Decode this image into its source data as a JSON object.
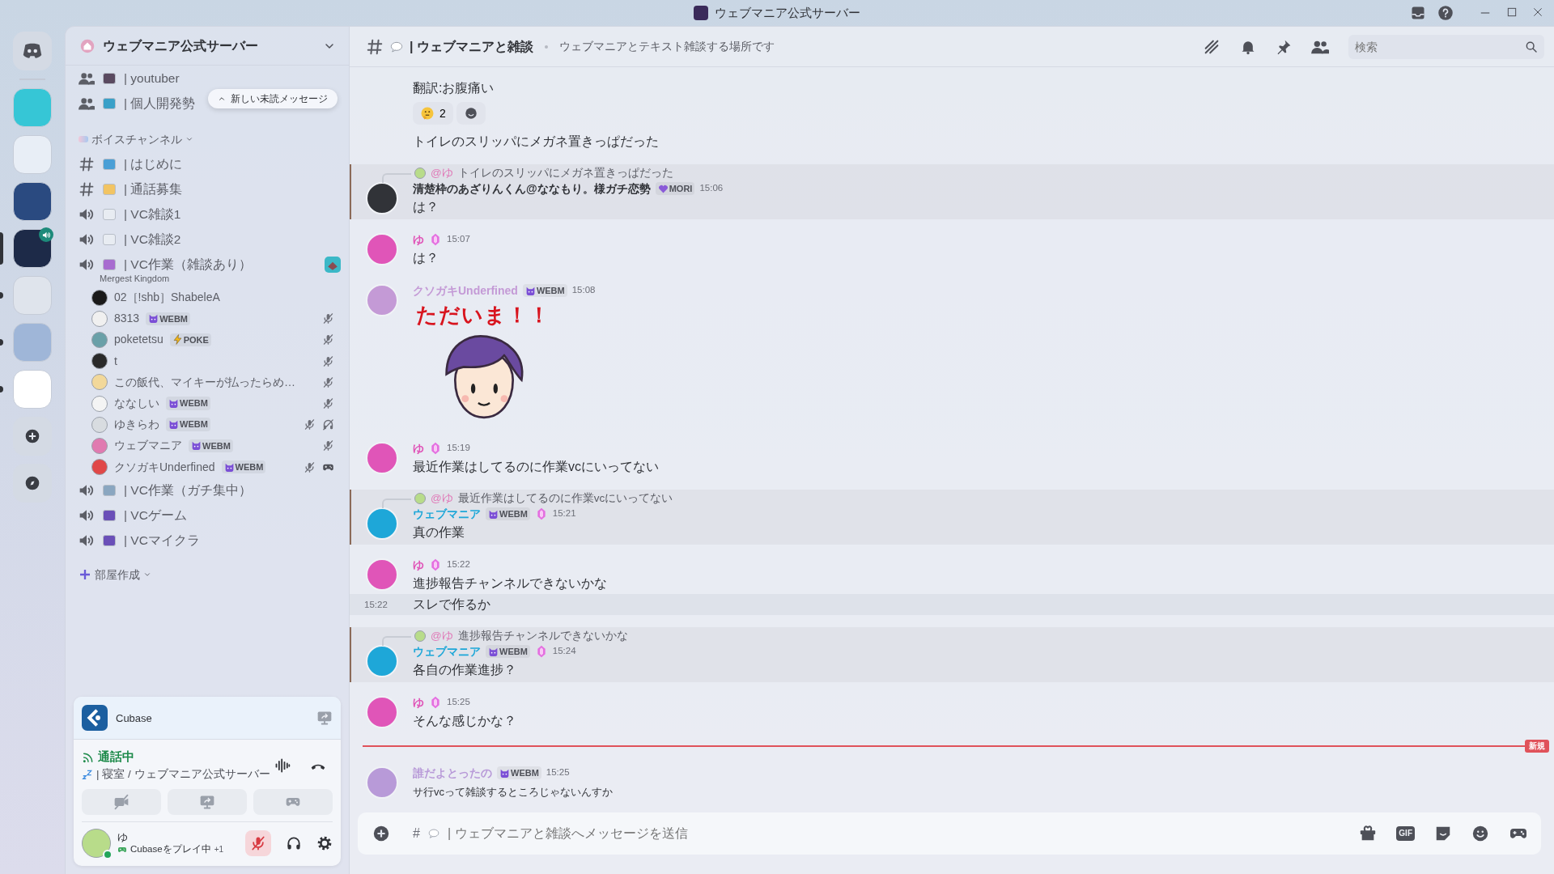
{
  "window": {
    "title": "ウェブマニア公式サーバー"
  },
  "servers": [
    {
      "kind": "home",
      "selected": false,
      "unread": false,
      "voice": false
    },
    {
      "kind": "server",
      "selected": false,
      "unread": false,
      "voice": false
    },
    {
      "kind": "server",
      "selected": false,
      "unread": false,
      "voice": false
    },
    {
      "kind": "server",
      "selected": false,
      "unread": false,
      "voice": false
    },
    {
      "kind": "server",
      "selected": true,
      "unread": false,
      "voice": true
    },
    {
      "kind": "server",
      "selected": false,
      "unread": true,
      "voice": false
    },
    {
      "kind": "server",
      "selected": false,
      "unread": true,
      "voice": false
    },
    {
      "kind": "server",
      "selected": false,
      "unread": true,
      "voice": false
    },
    {
      "kind": "add",
      "selected": false,
      "unread": false,
      "voice": false
    },
    {
      "kind": "discover",
      "selected": false,
      "unread": false,
      "voice": false
    }
  ],
  "server_header": {
    "name": "ウェブマニア公式サーバー"
  },
  "unread_pill": {
    "label": "新しい未読メッセージ"
  },
  "channels": [
    {
      "kind": "forum",
      "name": "| youtuber"
    },
    {
      "kind": "forum",
      "name": "| 個人開発勢"
    },
    {
      "kind": "category",
      "name": "ボイスチャンネル"
    },
    {
      "kind": "text",
      "name": "| はじめに"
    },
    {
      "kind": "text",
      "name": "| 通話募集"
    },
    {
      "kind": "voice",
      "name": "| VC雑談1"
    },
    {
      "kind": "voice",
      "name": "| VC雑談2"
    },
    {
      "kind": "voice",
      "name": "| VC作業（雑談あり）",
      "activity": "Mergest Kingdom",
      "members": [
        {
          "name": "02［!shb］ShabeleA",
          "muted": false,
          "deafened": false,
          "playing": false
        },
        {
          "name": "8313",
          "tag": {
            "label": "WEBM",
            "kind": "cat"
          },
          "muted": true,
          "deafened": false,
          "playing": false
        },
        {
          "name": "poketetsu",
          "tag": {
            "label": "POKE",
            "kind": "bolt"
          },
          "muted": true,
          "deafened": false,
          "playing": false
        },
        {
          "name": "t",
          "muted": true,
          "deafened": false,
          "playing": false
        },
        {
          "name": "この飯代、マイキーが払ったらめ…",
          "muted": true,
          "deafened": false,
          "playing": false
        },
        {
          "name": "ななしい",
          "tag": {
            "label": "WEBM",
            "kind": "cat"
          },
          "muted": true,
          "deafened": false,
          "playing": false
        },
        {
          "name": "ゆきらわ",
          "tag": {
            "label": "WEBM",
            "kind": "cat"
          },
          "muted": true,
          "deafened": true,
          "playing": false
        },
        {
          "name": "ウェブマニア",
          "tag": {
            "label": "WEBM",
            "kind": "cat"
          },
          "muted": true,
          "deafened": false,
          "playing": false
        },
        {
          "name": "クソガキUnderfined",
          "tag": {
            "label": "WEBM",
            "kind": "cat"
          },
          "muted": true,
          "deafened": false,
          "playing": true
        }
      ]
    },
    {
      "kind": "voice",
      "name": "| VC作業（ガチ集中）"
    },
    {
      "kind": "voice",
      "name": "| VCゲーム"
    },
    {
      "kind": "voice",
      "name": "| VCマイクラ"
    },
    {
      "kind": "create",
      "name": "部屋作成"
    }
  ],
  "voice_panel": {
    "activity": {
      "name": "Cubase"
    },
    "status": "通話中",
    "location": "| 寝室 / ウェブマニア公式サーバー",
    "camera_on": false
  },
  "user": {
    "name": "ゆ",
    "status": "Cubaseをプレイ中",
    "extra": "+1",
    "mic_muted": true,
    "online": true
  },
  "channel_header": {
    "name": "| ウェブマニアと雑談",
    "topic": "ウェブマニアとテキスト雑談する場所です",
    "search": {
      "placeholder": "検索"
    }
  },
  "messages": [
    {
      "kind": "message",
      "highlighted": false,
      "lines": [
        {
          "text": "翻訳:お腹痛い"
        }
      ],
      "reactions": [
        {
          "count": "2",
          "selected": false
        }
      ]
    },
    {
      "kind": "message",
      "highlighted": false,
      "lines": [
        {
          "text": "トイレのスリッパにメガネ置きっぱだった"
        }
      ]
    },
    {
      "kind": "message",
      "highlighted": true,
      "reply": {
        "mention": "@ゆ",
        "text": "トイレのスリッパにメガネ置きっぱだった"
      },
      "author": "清楚枠のあざりんくん@ななもり。様ガチ恋勢",
      "color": "#313338",
      "tag": {
        "label": "MORI",
        "kind": "heart"
      },
      "boost": false,
      "time": "15:06",
      "lines": [
        {
          "text": "は？"
        }
      ]
    },
    {
      "kind": "message",
      "highlighted": false,
      "author": "ゆ",
      "color": "#e055b8",
      "boost": true,
      "time": "15:07",
      "lines": [
        {
          "text": "は？"
        }
      ]
    },
    {
      "kind": "message",
      "highlighted": false,
      "author": "クソガキUnderfined",
      "color": "#c49ad6",
      "tag": {
        "label": "WEBM",
        "kind": "cat"
      },
      "boost": false,
      "time": "15:08",
      "sticker": {
        "caption": "ただいま！！"
      }
    },
    {
      "kind": "message",
      "highlighted": false,
      "author": "ゆ",
      "color": "#e055b8",
      "boost": true,
      "time": "15:19",
      "lines": [
        {
          "text": "最近作業はしてるのに作業vcにいってない"
        }
      ]
    },
    {
      "kind": "message",
      "highlighted": true,
      "reply": {
        "mention": "@ゆ",
        "text": "最近作業はしてるのに作業vcにいってない"
      },
      "author": "ウェブマニア",
      "color": "#1ea7d8",
      "tag": {
        "label": "WEBM",
        "kind": "cat"
      },
      "boost": true,
      "time": "15:21",
      "lines": [
        {
          "text": "真の作業"
        }
      ]
    },
    {
      "kind": "message",
      "highlighted": false,
      "author": "ゆ",
      "color": "#e055b8",
      "boost": true,
      "time": "15:22",
      "lines": [
        {
          "text": "進捗報告チャンネルできないかな"
        },
        {
          "text": "スレで作るか",
          "time": "15:22",
          "hovered": true
        }
      ]
    },
    {
      "kind": "message",
      "highlighted": true,
      "reply": {
        "mention": "@ゆ",
        "text": "進捗報告チャンネルできないかな"
      },
      "author": "ウェブマニア",
      "color": "#1ea7d8",
      "tag": {
        "label": "WEBM",
        "kind": "cat"
      },
      "boost": true,
      "time": "15:24",
      "lines": [
        {
          "text": "各自の作業進捗？"
        }
      ]
    },
    {
      "kind": "message",
      "highlighted": false,
      "author": "ゆ",
      "color": "#e055b8",
      "boost": true,
      "time": "15:25",
      "lines": [
        {
          "text": "そんな感じかな？"
        }
      ]
    },
    {
      "kind": "divider",
      "label": "新規"
    },
    {
      "kind": "message",
      "highlighted": false,
      "author": "誰だよとったの",
      "color": "#b89ad8",
      "tag": {
        "label": "WEBM",
        "kind": "cat"
      },
      "boost": false,
      "time": "15:25",
      "lines": [
        {
          "text": "サ行vcって雑談するところじゃないんすか"
        }
      ]
    }
  ],
  "composer": {
    "prefix": "#",
    "placeholder": "| ウェブマニアと雑談へメッセージを送信",
    "gif": "GIF"
  }
}
